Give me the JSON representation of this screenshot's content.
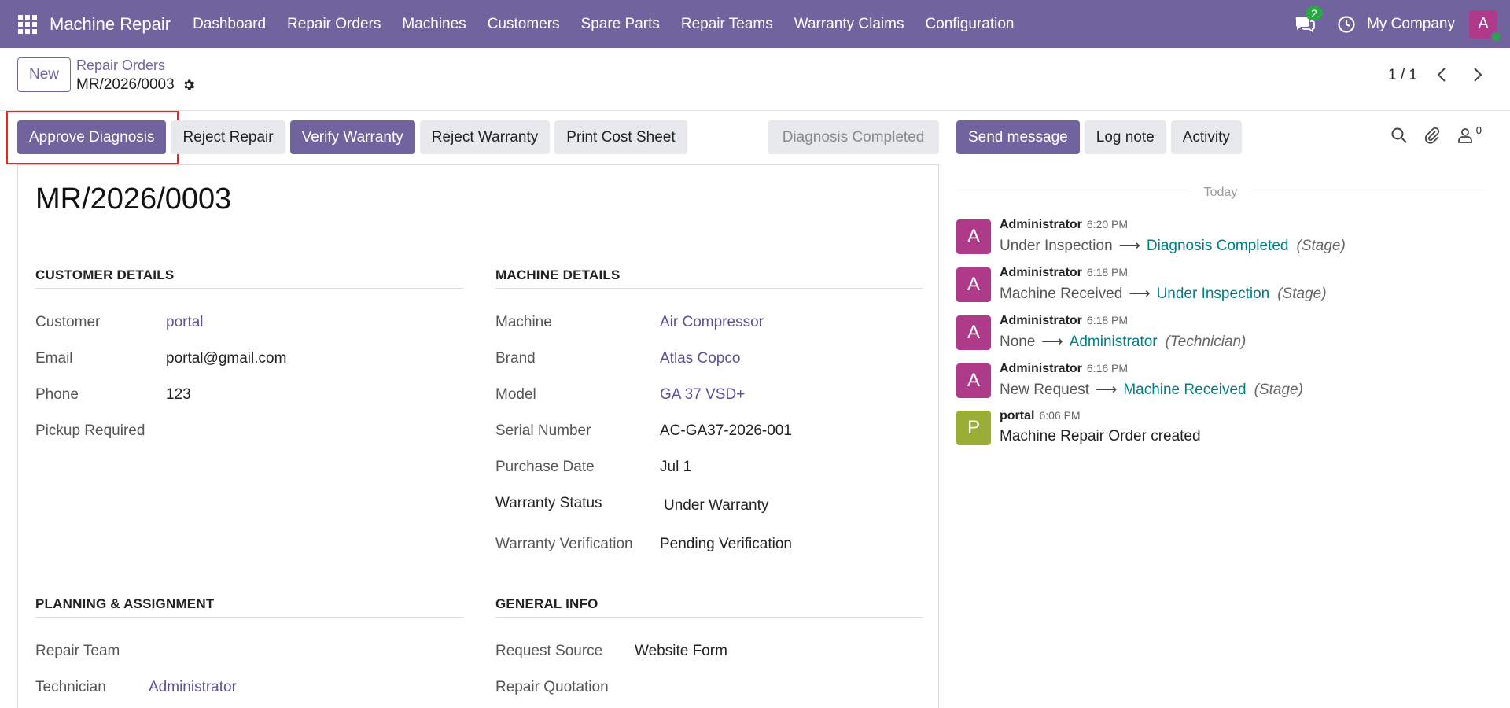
{
  "navbar": {
    "app_name": "Machine Repair",
    "menu": [
      "Dashboard",
      "Repair Orders",
      "Machines",
      "Customers",
      "Spare Parts",
      "Repair Teams",
      "Warranty Claims",
      "Configuration"
    ],
    "chat_count": "2",
    "company": "My Company",
    "user_initial": "A"
  },
  "control": {
    "new_label": "New",
    "breadcrumb_parent": "Repair Orders",
    "record_name": "MR/2026/0003",
    "pager": "1 / 1"
  },
  "actions": {
    "approve_diagnosis": "Approve Diagnosis",
    "reject_repair": "Reject Repair",
    "verify_warranty": "Verify Warranty",
    "reject_warranty": "Reject Warranty",
    "print_cost_sheet": "Print Cost Sheet",
    "status": "Diagnosis Completed"
  },
  "chatter_actions": {
    "send_message": "Send message",
    "log_note": "Log note",
    "activity": "Activity",
    "followers": "0"
  },
  "form": {
    "title": "MR/2026/0003",
    "customer_section": "CUSTOMER DETAILS",
    "machine_section": "MACHINE DETAILS",
    "planning_section": "PLANNING & ASSIGNMENT",
    "general_section": "GENERAL INFO",
    "customer": {
      "customer_label": "Customer",
      "customer_value": "portal",
      "email_label": "Email",
      "email_value": "portal@gmail.com",
      "phone_label": "Phone",
      "phone_value": "123",
      "pickup_label": "Pickup Required"
    },
    "machine": {
      "machine_label": "Machine",
      "machine_value": "Air Compressor",
      "brand_label": "Brand",
      "brand_value": "Atlas Copco",
      "model_label": "Model",
      "model_value": "GA 37 VSD+",
      "serial_label": "Serial Number",
      "serial_value": "AC-GA37-2026-001",
      "purchase_label": "Purchase Date",
      "purchase_value": "Jul 1",
      "warranty_status_label": "Warranty Status",
      "warranty_status_value": "Under Warranty",
      "warranty_verif_label": "Warranty Verification",
      "warranty_verif_value": "Pending Verification"
    },
    "planning": {
      "team_label": "Repair Team",
      "technician_label": "Technician",
      "technician_value": "Administrator"
    },
    "general": {
      "source_label": "Request Source",
      "source_value": "Website Form",
      "quotation_label": "Repair Quotation"
    }
  },
  "chatter": {
    "today": "Today",
    "messages": [
      {
        "initial": "A",
        "author": "Administrator",
        "time": "6:20 PM",
        "old": "Under Inspection",
        "new": "Diagnosis Completed",
        "field": "(Stage)",
        "color": "#b03a8a"
      },
      {
        "initial": "A",
        "author": "Administrator",
        "time": "6:18 PM",
        "old": "Machine Received",
        "new": "Under Inspection",
        "field": "(Stage)",
        "color": "#b03a8a"
      },
      {
        "initial": "A",
        "author": "Administrator",
        "time": "6:18 PM",
        "old": "None",
        "new": "Administrator",
        "field": "(Technician)",
        "color": "#b03a8a"
      },
      {
        "initial": "A",
        "author": "Administrator",
        "time": "6:16 PM",
        "old": "New Request",
        "new": "Machine Received",
        "field": "(Stage)",
        "color": "#b03a8a"
      },
      {
        "initial": "P",
        "author": "portal",
        "time": "6:06 PM",
        "text": "Machine Repair Order created",
        "color": "#9aae36"
      }
    ]
  }
}
